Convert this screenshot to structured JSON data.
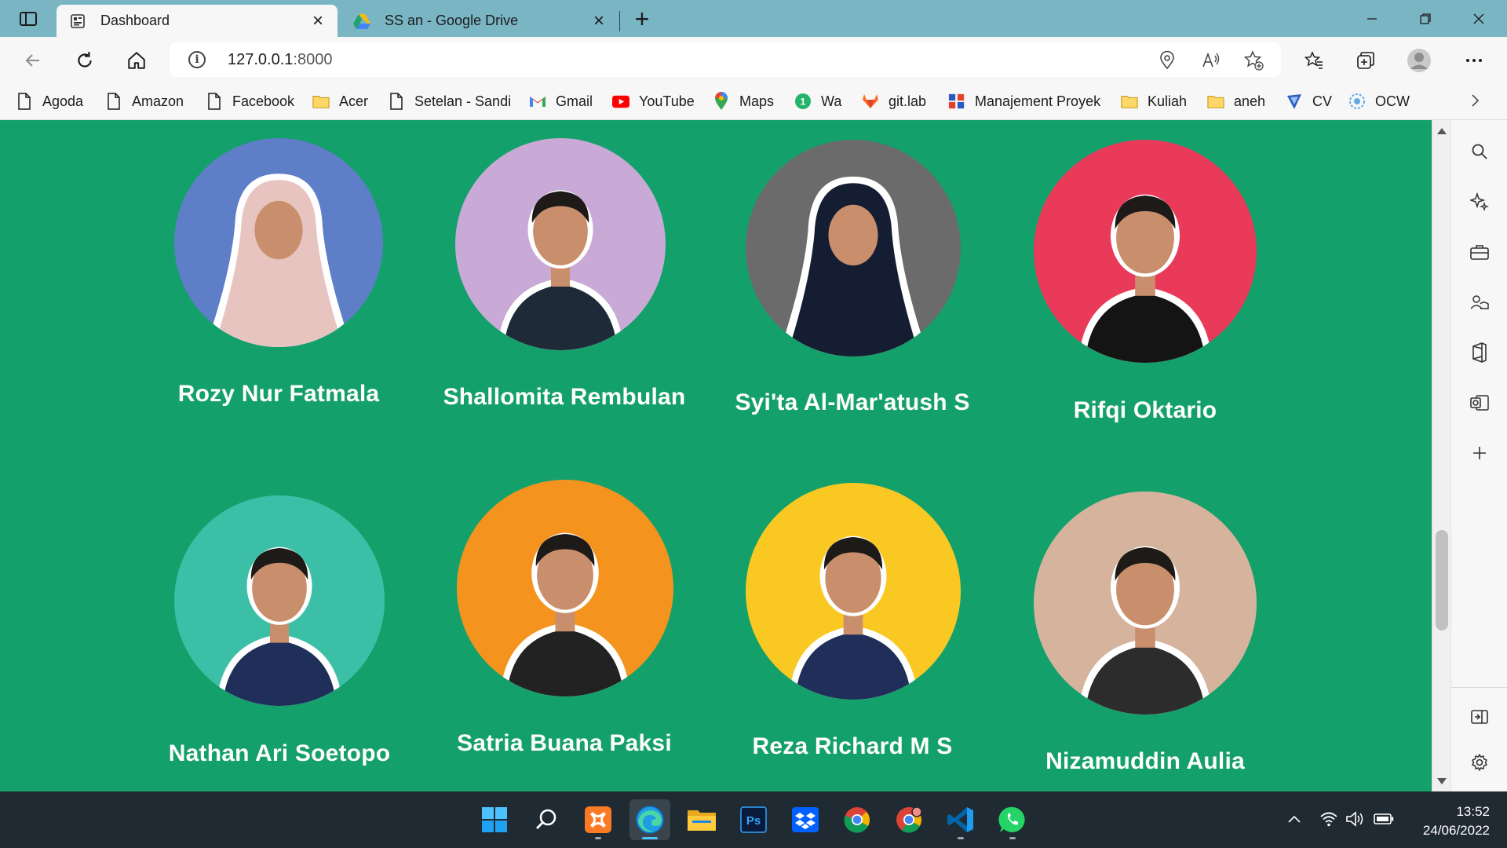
{
  "browser": {
    "tabs": [
      {
        "title": "Dashboard",
        "active": true,
        "icon": "dashboard-icon"
      },
      {
        "title": "SS an - Google Drive",
        "active": false,
        "icon": "google-drive-icon"
      }
    ],
    "url": {
      "host": "127.0.0.1",
      "port": ":8000"
    }
  },
  "bookmarks": [
    {
      "label": "Agoda",
      "icon": "page-icon"
    },
    {
      "label": "Amazon",
      "icon": "page-icon"
    },
    {
      "label": "Facebook",
      "icon": "page-icon"
    },
    {
      "label": "Acer",
      "icon": "folder-icon"
    },
    {
      "label": "Setelan - Sandi",
      "icon": "page-icon"
    },
    {
      "label": "Gmail",
      "icon": "gmail-icon"
    },
    {
      "label": "YouTube",
      "icon": "youtube-icon"
    },
    {
      "label": "Maps",
      "icon": "maps-icon"
    },
    {
      "label": "Wa",
      "icon": "whatsapp-badge-icon"
    },
    {
      "label": "git.lab",
      "icon": "gitlab-icon"
    },
    {
      "label": "Manajement Proyek",
      "icon": "project-icon"
    },
    {
      "label": "Kuliah",
      "icon": "folder-icon"
    },
    {
      "label": "aneh",
      "icon": "folder-icon"
    },
    {
      "label": "CV",
      "icon": "cv-icon"
    },
    {
      "label": "OCW",
      "icon": "ocw-icon"
    }
  ],
  "team": [
    {
      "name": "Rozy Nur Fatmala",
      "bg": "#5e7ec8",
      "outfit": "#e8c4c0",
      "hijab": true
    },
    {
      "name": "Shallomita Rembulan",
      "bg": "#c9a9d6",
      "outfit": "#1f2a38",
      "hijab": false
    },
    {
      "name": "Syi'ta Al-Mar'atush S",
      "bg": "#6b6b6b",
      "outfit": "#151d33",
      "hijab": true
    },
    {
      "name": "Rifqi Oktario",
      "bg": "#ea3a5a",
      "outfit": "#141414",
      "hijab": false
    },
    {
      "name": "Nathan Ari Soetopo",
      "bg": "#3cbfa7",
      "outfit": "#1f2f5a",
      "hijab": false
    },
    {
      "name": "Satria Buana Paksi",
      "bg": "#f5931f",
      "outfit": "#222222",
      "hijab": false
    },
    {
      "name": "Reza Richard M S",
      "bg": "#f9c823",
      "outfit": "#1f2f5a",
      "hijab": false
    },
    {
      "name": "Nizamuddin Aulia",
      "bg": "#d5b39c",
      "outfit": "#2c2c2c",
      "hijab": false
    }
  ],
  "taskbar": {
    "apps": [
      "windows-start-icon",
      "search-icon",
      "xampp-icon",
      "edge-icon",
      "file-explorer-icon",
      "photoshop-icon",
      "dropbox-icon",
      "chrome-icon",
      "chrome-profile-icon",
      "vscode-icon",
      "whatsapp-icon"
    ],
    "time": "13:52",
    "date": "24/06/2022"
  },
  "colors": {
    "page_bg": "#14a06b",
    "tabbar": "#7ab5c4",
    "taskbar": "#202a33"
  }
}
